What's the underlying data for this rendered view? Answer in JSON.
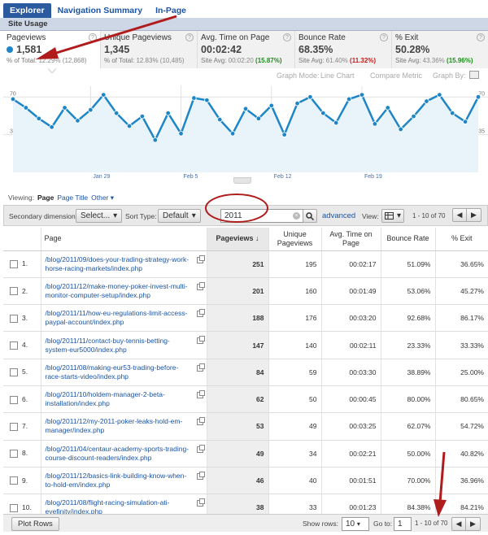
{
  "tabs": [
    "Explorer",
    "Navigation Summary",
    "In-Page"
  ],
  "subtab": "Site Usage",
  "metrics": [
    {
      "label": "Pageviews",
      "value": "1,581",
      "sub1": "% of Total: ",
      "sub2": "12.29% (12,868)",
      "sub3": ""
    },
    {
      "label": "Unique Pageviews",
      "value": "1,345",
      "sub1": "% of Total: ",
      "sub2": "12.83% (10,485)",
      "sub3": ""
    },
    {
      "label": "Avg. Time on Page",
      "value": "00:02:42",
      "sub1": "Site Avg: ",
      "sub2": "00:02:20",
      "sub3": "(15.87%)"
    },
    {
      "label": "Bounce Rate",
      "value": "68.35%",
      "sub1": "Site Avg: ",
      "sub2": "61.40%",
      "sub3": "(11.32%)"
    },
    {
      "label": "% Exit",
      "value": "50.28%",
      "sub1": "Site Avg: ",
      "sub2": "43.36%",
      "sub3": "(15.96%)"
    }
  ],
  "graph_controls": {
    "mode_label": "Graph Mode:",
    "mode_value": "Line Chart",
    "compare": "Compare Metric",
    "graph_by": "Graph By:"
  },
  "chart_data": {
    "type": "line",
    "series": [
      {
        "values": [
          68,
          60,
          50,
          42,
          60,
          48,
          58,
          72,
          55,
          43,
          52,
          30,
          55,
          36,
          69,
          67,
          49,
          36,
          59,
          50,
          62,
          35,
          64,
          70,
          55,
          46,
          68,
          72,
          45,
          60,
          40,
          52,
          66,
          72,
          55,
          47,
          70
        ]
      }
    ],
    "y_ticks": [
      "70",
      "35"
    ],
    "x_ticks": [
      "Jan 29",
      "Feb 5",
      "Feb 12",
      "Feb 19"
    ],
    "ylim": [
      0,
      80
    ],
    "color": "#1e86c6"
  },
  "viewing": {
    "label": "Viewing:",
    "page": "Page",
    "page_title": "Page Title",
    "other": "Other"
  },
  "toolbar": {
    "secondary_label": "Secondary dimension:",
    "select": "Select...",
    "sort_label": "Sort Type:",
    "sort_value": "Default",
    "search_value": "2011",
    "advanced": "advanced",
    "view_label": "View:",
    "range": "1 - 10 of 70"
  },
  "table": {
    "headers": [
      "Page",
      "Pageviews",
      "Unique Pageviews",
      "Avg. Time on Page",
      "Bounce Rate",
      "% Exit"
    ],
    "rows": [
      {
        "n": "1.",
        "page": "/blog/2011/09/does-your-trading-strategy-work-horse-racing-markets/index.php",
        "pv": "251",
        "upv": "195",
        "time": "00:02:17",
        "br": "51.09%",
        "exit": "36.65%"
      },
      {
        "n": "2.",
        "page": "/blog/2011/12/make-money-poker-invest-multi-monitor-computer-setup/index.php",
        "pv": "201",
        "upv": "160",
        "time": "00:01:49",
        "br": "53.06%",
        "exit": "45.27%"
      },
      {
        "n": "3.",
        "page": "/blog/2011/11/how-eu-regulations-limit-access-paypal-account/index.php",
        "pv": "188",
        "upv": "176",
        "time": "00:03:20",
        "br": "92.68%",
        "exit": "86.17%"
      },
      {
        "n": "4.",
        "page": "/blog/2011/11/contact-buy-tennis-betting-system-eur5000/index.php",
        "pv": "147",
        "upv": "140",
        "time": "00:02:11",
        "br": "23.33%",
        "exit": "33.33%"
      },
      {
        "n": "5.",
        "page": "/blog/2011/08/making-eur53-trading-before-race-starts-video/index.php",
        "pv": "84",
        "upv": "59",
        "time": "00:03:30",
        "br": "38.89%",
        "exit": "25.00%"
      },
      {
        "n": "6.",
        "page": "/blog/2011/10/holdem-manager-2-beta-installation/index.php",
        "pv": "62",
        "upv": "50",
        "time": "00:00:45",
        "br": "80.00%",
        "exit": "80.65%"
      },
      {
        "n": "7.",
        "page": "/blog/2011/12/my-2011-poker-leaks-hold-em-manager/index.php",
        "pv": "53",
        "upv": "49",
        "time": "00:03:25",
        "br": "62.07%",
        "exit": "54.72%"
      },
      {
        "n": "8.",
        "page": "/blog/2011/04/centaur-academy-sports-trading-course-discount-readers/index.php",
        "pv": "49",
        "upv": "34",
        "time": "00:02:21",
        "br": "50.00%",
        "exit": "40.82%"
      },
      {
        "n": "9.",
        "page": "/blog/2011/12/basics-link-building-know-when-to-hold-em/index.php",
        "pv": "46",
        "upv": "40",
        "time": "00:01:51",
        "br": "70.00%",
        "exit": "36.96%"
      },
      {
        "n": "10.",
        "page": "/blog/2011/08/flight-racing-simulation-ati-eyefinity/index.php",
        "pv": "38",
        "upv": "33",
        "time": "00:01:23",
        "br": "84.38%",
        "exit": "84.21%"
      }
    ]
  },
  "footer": {
    "plot_rows": "Plot Rows",
    "show_rows_label": "Show rows:",
    "show_rows_value": "10",
    "goto_label": "Go to:",
    "goto_value": "1",
    "range": "1 - 10 of 70"
  },
  "colors": {
    "accent": "#1e86c6",
    "annotation": "#b01c1c"
  }
}
